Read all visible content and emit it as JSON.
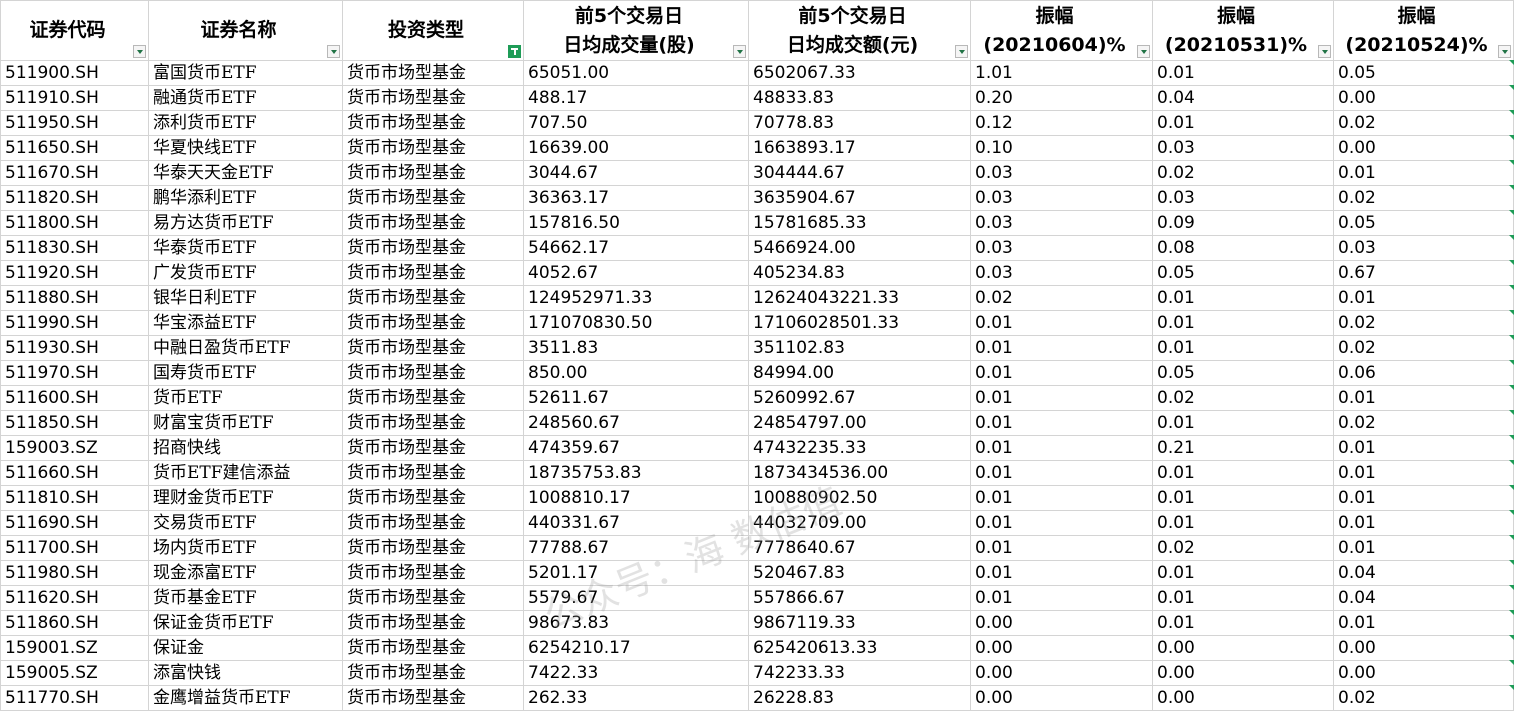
{
  "headers": [
    {
      "line1": "证券代码",
      "line2": ""
    },
    {
      "line1": "证券名称",
      "line2": ""
    },
    {
      "line1": "投资类型",
      "line2": ""
    },
    {
      "line1": "前5个交易日",
      "line2": "日均成交量(股)"
    },
    {
      "line1": "前5个交易日",
      "line2": "日均成交额(元)"
    },
    {
      "line1": "振幅",
      "line2": "(20210604)%"
    },
    {
      "line1": "振幅",
      "line2": "(20210531)%"
    },
    {
      "line1": "振幅",
      "line2": "(20210524)%"
    }
  ],
  "rows": [
    [
      "511900.SH",
      "富国货币ETF",
      "货币市场型基金",
      "65051.00",
      "6502067.33",
      "1.01",
      "0.01",
      "0.05"
    ],
    [
      "511910.SH",
      "融通货币ETF",
      "货币市场型基金",
      "488.17",
      "48833.83",
      "0.20",
      "0.04",
      "0.00"
    ],
    [
      "511950.SH",
      "添利货币ETF",
      "货币市场型基金",
      "707.50",
      "70778.83",
      "0.12",
      "0.01",
      "0.02"
    ],
    [
      "511650.SH",
      "华夏快线ETF",
      "货币市场型基金",
      "16639.00",
      "1663893.17",
      "0.10",
      "0.03",
      "0.00"
    ],
    [
      "511670.SH",
      "华泰天天金ETF",
      "货币市场型基金",
      "3044.67",
      "304444.67",
      "0.03",
      "0.02",
      "0.01"
    ],
    [
      "511820.SH",
      "鹏华添利ETF",
      "货币市场型基金",
      "36363.17",
      "3635904.67",
      "0.03",
      "0.03",
      "0.02"
    ],
    [
      "511800.SH",
      "易方达货币ETF",
      "货币市场型基金",
      "157816.50",
      "15781685.33",
      "0.03",
      "0.09",
      "0.05"
    ],
    [
      "511830.SH",
      "华泰货币ETF",
      "货币市场型基金",
      "54662.17",
      "5466924.00",
      "0.03",
      "0.08",
      "0.03"
    ],
    [
      "511920.SH",
      "广发货币ETF",
      "货币市场型基金",
      "4052.67",
      "405234.83",
      "0.03",
      "0.05",
      "0.67"
    ],
    [
      "511880.SH",
      "银华日利ETF",
      "货币市场型基金",
      "124952971.33",
      "12624043221.33",
      "0.02",
      "0.01",
      "0.01"
    ],
    [
      "511990.SH",
      "华宝添益ETF",
      "货币市场型基金",
      "171070830.50",
      "17106028501.33",
      "0.01",
      "0.01",
      "0.02"
    ],
    [
      "511930.SH",
      "中融日盈货币ETF",
      "货币市场型基金",
      "3511.83",
      "351102.83",
      "0.01",
      "0.01",
      "0.02"
    ],
    [
      "511970.SH",
      "国寿货币ETF",
      "货币市场型基金",
      "850.00",
      "84994.00",
      "0.01",
      "0.05",
      "0.06"
    ],
    [
      "511600.SH",
      "货币ETF",
      "货币市场型基金",
      "52611.67",
      "5260992.67",
      "0.01",
      "0.02",
      "0.01"
    ],
    [
      "511850.SH",
      "财富宝货币ETF",
      "货币市场型基金",
      "248560.67",
      "24854797.00",
      "0.01",
      "0.01",
      "0.02"
    ],
    [
      "159003.SZ",
      "招商快线",
      "货币市场型基金",
      "474359.67",
      "47432235.33",
      "0.01",
      "0.21",
      "0.01"
    ],
    [
      "511660.SH",
      "货币ETF建信添益",
      "货币市场型基金",
      "18735753.83",
      "1873434536.00",
      "0.01",
      "0.01",
      "0.01"
    ],
    [
      "511810.SH",
      "理财金货币ETF",
      "货币市场型基金",
      "1008810.17",
      "100880902.50",
      "0.01",
      "0.01",
      "0.01"
    ],
    [
      "511690.SH",
      "交易货币ETF",
      "货币市场型基金",
      "440331.67",
      "44032709.00",
      "0.01",
      "0.01",
      "0.01"
    ],
    [
      "511700.SH",
      "场内货币ETF",
      "货币市场型基金",
      "77788.67",
      "7778640.67",
      "0.01",
      "0.02",
      "0.01"
    ],
    [
      "511980.SH",
      "现金添富ETF",
      "货币市场型基金",
      "5201.17",
      "520467.83",
      "0.01",
      "0.01",
      "0.04"
    ],
    [
      "511620.SH",
      "货币基金ETF",
      "货币市场型基金",
      "5579.67",
      "557866.67",
      "0.01",
      "0.01",
      "0.04"
    ],
    [
      "511860.SH",
      "保证金货币ETF",
      "货币市场型基金",
      "98673.83",
      "9867119.33",
      "0.00",
      "0.01",
      "0.01"
    ],
    [
      "159001.SZ",
      "保证金",
      "货币市场型基金",
      "6254210.17",
      "625420613.33",
      "0.00",
      "0.00",
      "0.00"
    ],
    [
      "159005.SZ",
      "添富快钱",
      "货币市场型基金",
      "7422.33",
      "742233.33",
      "0.00",
      "0.00",
      "0.00"
    ],
    [
      "511770.SH",
      "金鹰增益货币ETF",
      "货币市场型基金",
      "262.33",
      "26228.83",
      "0.00",
      "0.00",
      "0.02"
    ]
  ],
  "watermark": "公众号：海  数估值",
  "colors": {
    "grid": "#d4d4d4",
    "filter_active": "#1e9c57"
  },
  "icons": {
    "filter": "dropdown-arrow-icon",
    "filter_active": "filter-funnel-icon"
  }
}
